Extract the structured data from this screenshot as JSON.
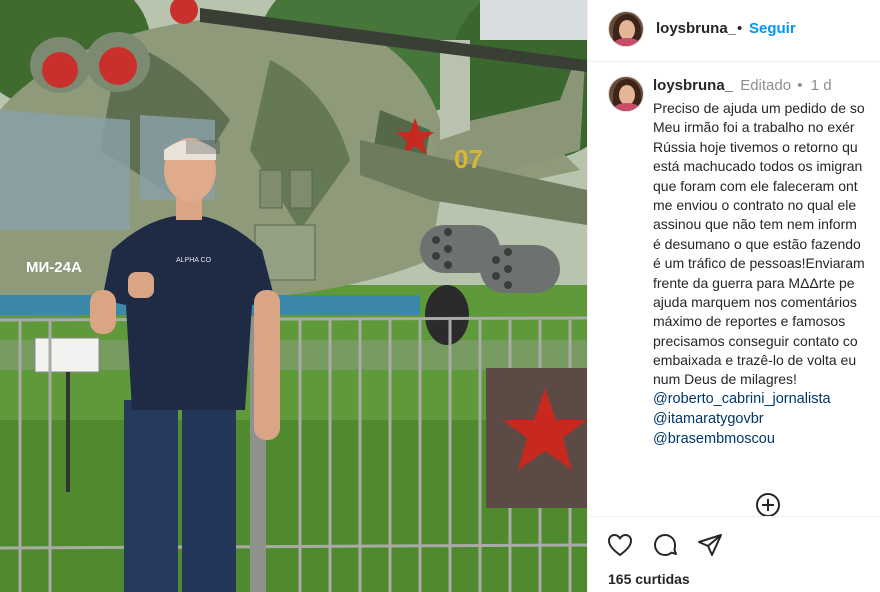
{
  "photo": {
    "helicopter_marking": "МИ-24А",
    "tail_number": "07",
    "shirt_logo": "ALPHA CO",
    "colors": {
      "camo_light": "#8e9a7a",
      "camo_dark": "#56684a",
      "grass": "#5e9a3a",
      "star_red": "#c8291f"
    }
  },
  "header": {
    "username": "loysbruna_",
    "separator": "•",
    "follow_label": "Seguir"
  },
  "post": {
    "username": "loysbruna_",
    "edited_label": "Editado",
    "separator": "•",
    "time": "1 d",
    "caption_lines": [
      "Preciso de ajuda um pedido de so",
      "Meu irmão foi a trabalho no exér",
      "Rússia hoje tivemos o retorno qu",
      "está machucado todos os imigran",
      "que foram com ele faleceram ont",
      "me enviou o contrato no qual ele",
      "assinou que não tem nem inform",
      "é desumano o que estão fazendo",
      "é um tráfico de pessoas!Enviaram",
      "frente da guerra para MΔΔrte pe",
      "ajuda marquem nos comentários",
      "máximo de reportes e famosos",
      "precisamos conseguir contato co",
      "embaixada e trazê-lo de volta eu",
      "num Deus de milagres!"
    ],
    "mentions": [
      "@roberto_cabrini_jornalista",
      "@itamaratygovbr",
      "@brasembmoscou"
    ],
    "more_icon": "plus-circle-icon"
  },
  "actions": {
    "icons": [
      "heart-icon",
      "comment-icon",
      "share-icon"
    ],
    "likes": "165 curtidas"
  }
}
